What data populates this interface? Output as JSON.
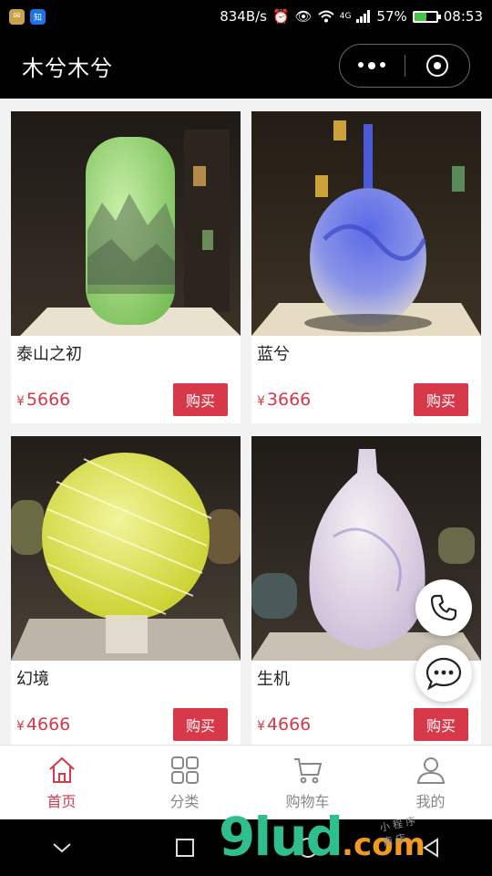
{
  "status": {
    "net_speed": "834B/s",
    "network_type": "4G",
    "battery_percent": "57%",
    "battery_level": 0.57,
    "time": "08:53",
    "app_icons": [
      {
        "name": "mail-icon",
        "color": "#c9a24a",
        "glyph": "✉"
      },
      {
        "name": "zhihu-icon",
        "color": "#1a73e8",
        "glyph": "知"
      }
    ]
  },
  "header": {
    "title": "木兮木兮",
    "more_icon": "more-dots-icon",
    "close_icon": "target-circle-icon"
  },
  "products": [
    {
      "name": "泰山之初",
      "currency": "¥",
      "price": "5666",
      "buy_label": "购买",
      "image": "green-glass-vase-mountains"
    },
    {
      "name": "蓝兮",
      "currency": "¥",
      "price": "3666",
      "buy_label": "购买",
      "image": "blue-glass-bottle-vase"
    },
    {
      "name": "幻境",
      "currency": "¥",
      "price": "4666",
      "buy_label": "购买",
      "image": "yellow-swirl-glass-sphere"
    },
    {
      "name": "生机",
      "currency": "¥",
      "price": "4666",
      "buy_label": "购买",
      "image": "white-lavender-glass-vase"
    }
  ],
  "floating": {
    "phone_icon": "phone-icon",
    "chat_icon": "chat-bubble-icon"
  },
  "tabs": [
    {
      "label": "首页",
      "icon": "home-icon",
      "active": true
    },
    {
      "label": "分类",
      "icon": "grid-icon",
      "active": false
    },
    {
      "label": "购物车",
      "icon": "cart-icon",
      "active": false
    },
    {
      "label": "我的",
      "icon": "user-icon",
      "active": false
    }
  ],
  "watermark": {
    "main": "9lud",
    "domain": ".com",
    "sub": "小 程 序 商 店"
  },
  "colors": {
    "accent": "#d43a4a",
    "tab_inactive": "#888888",
    "header_bg": "#000000"
  }
}
